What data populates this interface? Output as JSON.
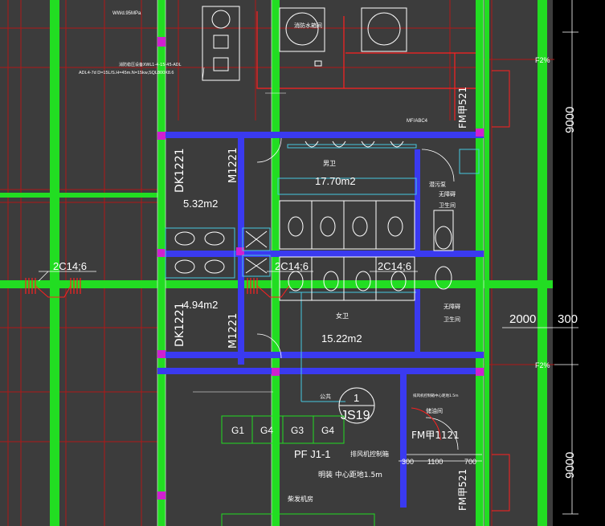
{
  "colors": {
    "background": "#3c3c3c",
    "column": "#22dd22",
    "wall": "#3a3af0",
    "grid_red": "#c01818",
    "accent_red": "#ff2020",
    "fixture": "#ffffff",
    "cyan": "#46c8e0",
    "magenta": "#d020d0",
    "outer_black": "#000000"
  },
  "labels": {
    "note_top": "WWd.95MPa",
    "spec_line": "ADL4-7d D=15L/S.H=45m.N=15kw,SQL800X8.6",
    "spec_line_top": "消防稳压设备XWL1-4-15-45-ADL",
    "tank_label": "消防水箱间",
    "pump_label": "潜污泵",
    "vent_label": "MF/ABC4",
    "fm_top": "FM甲521",
    "fm_bottom": "FM甲521",
    "fm_room": "FM甲1121",
    "dk_upper": "DK1221",
    "dk_lower": "DK1221",
    "m_upper": "M1221",
    "m_lower": "M1221",
    "men_room": "男卫",
    "men_area": "17.70m2",
    "women_room": "女卫",
    "women_area": "15.22m2",
    "janitor_area_upper": "5.32m2",
    "janitor_area_lower": "4.94m2",
    "acc_upper_1": "无障碍",
    "acc_upper_2": "卫生间",
    "acc_lower_1": "无障碍",
    "acc_lower_2": "卫生间",
    "beam_left": "2C14;6",
    "beam_mid": "2C14;6",
    "beam_right": "2C14;6",
    "slope_top": "F2%",
    "slope_bottom": "F2%",
    "corridor": "公共",
    "detail_no": "1",
    "detail_ref": "JS19",
    "g_boxes": [
      "G1",
      "G4",
      "G3",
      "G4"
    ],
    "pf_label": "PF J1-1",
    "fan_ctrl": "排风机控制箱",
    "mount_note": "明装  中心距地1.5m",
    "room_tag": "储油间",
    "fire_room": "柴发机房",
    "sub_dims": [
      "300",
      "1100",
      "700"
    ],
    "dim_9000_top": "9000",
    "dim_9000_bottom": "9000",
    "dim_2000": "2000",
    "dim_300": "300",
    "small_note_right": "排风机控制箱中心距地1.5m"
  }
}
